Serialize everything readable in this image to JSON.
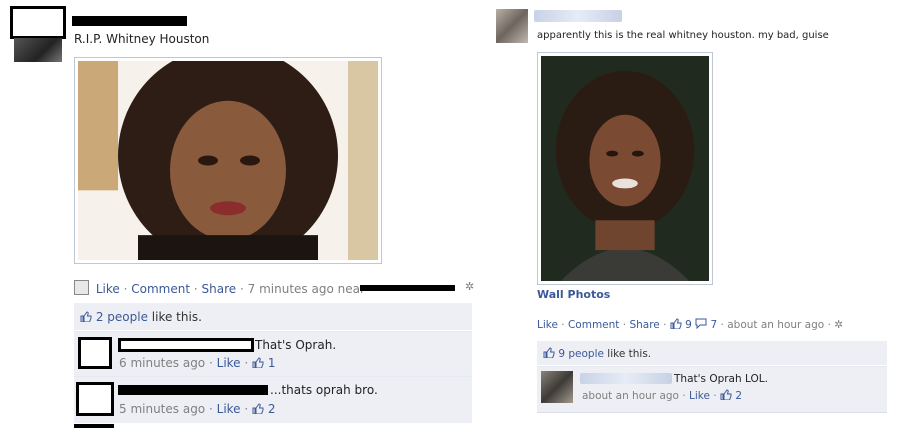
{
  "left_post": {
    "caption": "R.I.P. Whitney Houston",
    "actions": {
      "like": "Like",
      "comment": "Comment",
      "share": "Share",
      "time": "7 minutes ago near",
      "separator": "·"
    },
    "likes_count": "2 people",
    "likes_suffix": "like this.",
    "comments": [
      {
        "text": "That's Oprah.",
        "time": "6 minutes ago",
        "like": "Like",
        "likes": "1"
      },
      {
        "text": "...thats oprah bro.",
        "time": "5 minutes ago",
        "like": "Like",
        "likes": "2"
      }
    ]
  },
  "right_post": {
    "caption": "apparently this is the real whitney houston. my bad, guise",
    "album_link": "Wall Photos",
    "actions": {
      "like": "Like",
      "comment": "Comment",
      "share": "Share",
      "like_count": "9",
      "comment_count": "7",
      "time": "about an hour ago"
    },
    "likes_count": "9 people",
    "likes_suffix": "like this.",
    "comments": [
      {
        "text": "That's Oprah LOL.",
        "time": "about an hour ago",
        "like": "Like",
        "likes": "2"
      }
    ]
  },
  "icons": {
    "thumbs_up": "thumbs-up-icon",
    "speech": "speech-bubble-icon",
    "globe": "privacy-globe-icon",
    "app": "mobile-upload-icon"
  },
  "colors": {
    "link": "#3b5998",
    "ufi_bg": "#edeff4",
    "muted": "#808080"
  }
}
